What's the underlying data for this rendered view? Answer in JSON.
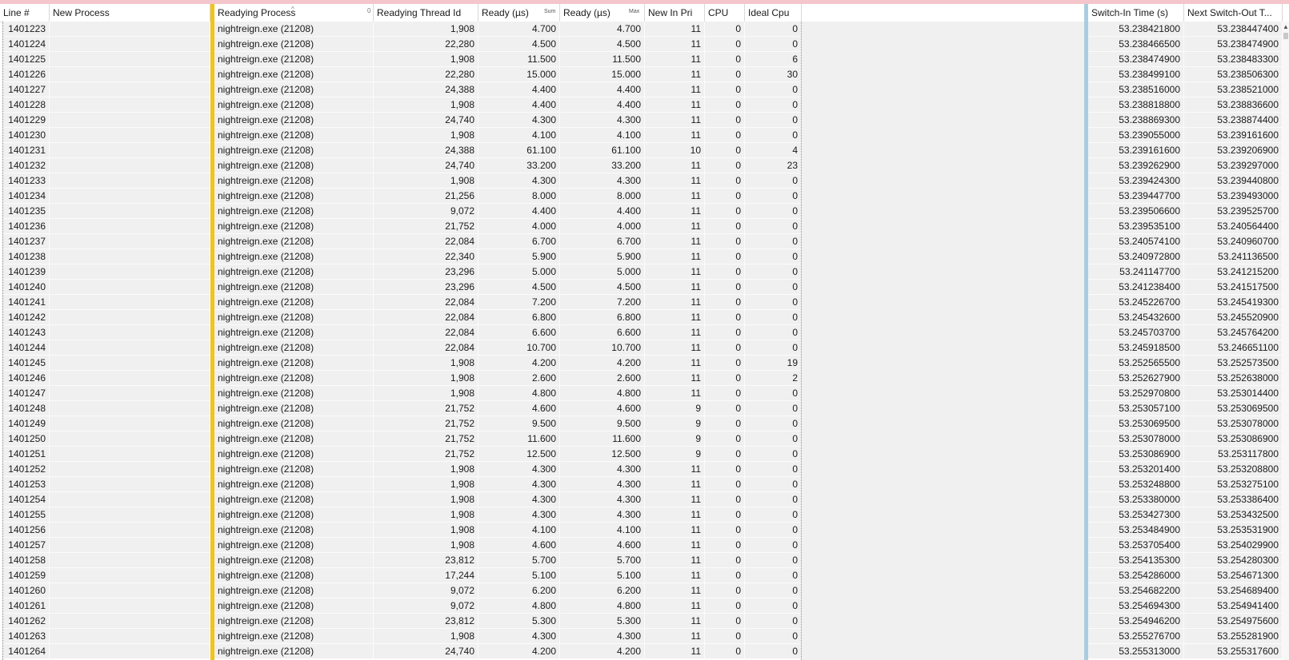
{
  "columns": {
    "line": "Line #",
    "new_process": "New Process",
    "readying_process": "Readying Process",
    "readying_thread_id": "Readying Thread Id",
    "ready_sum": "Ready (µs)",
    "ready_sum_agg": "Sum",
    "ready_max": "Ready (µs)",
    "ready_max_agg": "Max",
    "new_in_pri": "New In Pri",
    "cpu": "CPU",
    "ideal_cpu": "Ideal Cpu",
    "switch_in_time": "Switch-In Time (s)",
    "next_switch_out": "Next Switch-Out T..."
  },
  "header_marks": {
    "sort_arrow": "^",
    "group_mark": "0"
  },
  "rows": [
    {
      "line": "1401223",
      "proc": "nightreign.exe (21208)",
      "tid": "1,908",
      "sum": "4.700",
      "max": "4.700",
      "pri": "11",
      "cpu": "0",
      "ideal": "0",
      "sin": "53.238421800",
      "sout": "53.238447400"
    },
    {
      "line": "1401224",
      "proc": "nightreign.exe (21208)",
      "tid": "22,280",
      "sum": "4.500",
      "max": "4.500",
      "pri": "11",
      "cpu": "0",
      "ideal": "0",
      "sin": "53.238466500",
      "sout": "53.238474900"
    },
    {
      "line": "1401225",
      "proc": "nightreign.exe (21208)",
      "tid": "1,908",
      "sum": "11.500",
      "max": "11.500",
      "pri": "11",
      "cpu": "0",
      "ideal": "6",
      "sin": "53.238474900",
      "sout": "53.238483300"
    },
    {
      "line": "1401226",
      "proc": "nightreign.exe (21208)",
      "tid": "22,280",
      "sum": "15.000",
      "max": "15.000",
      "pri": "11",
      "cpu": "0",
      "ideal": "30",
      "sin": "53.238499100",
      "sout": "53.238506300"
    },
    {
      "line": "1401227",
      "proc": "nightreign.exe (21208)",
      "tid": "24,388",
      "sum": "4.400",
      "max": "4.400",
      "pri": "11",
      "cpu": "0",
      "ideal": "0",
      "sin": "53.238516000",
      "sout": "53.238521000"
    },
    {
      "line": "1401228",
      "proc": "nightreign.exe (21208)",
      "tid": "1,908",
      "sum": "4.400",
      "max": "4.400",
      "pri": "11",
      "cpu": "0",
      "ideal": "0",
      "sin": "53.238818800",
      "sout": "53.238836600"
    },
    {
      "line": "1401229",
      "proc": "nightreign.exe (21208)",
      "tid": "24,740",
      "sum": "4.300",
      "max": "4.300",
      "pri": "11",
      "cpu": "0",
      "ideal": "0",
      "sin": "53.238869300",
      "sout": "53.238874400"
    },
    {
      "line": "1401230",
      "proc": "nightreign.exe (21208)",
      "tid": "1,908",
      "sum": "4.100",
      "max": "4.100",
      "pri": "11",
      "cpu": "0",
      "ideal": "0",
      "sin": "53.239055000",
      "sout": "53.239161600"
    },
    {
      "line": "1401231",
      "proc": "nightreign.exe (21208)",
      "tid": "24,388",
      "sum": "61.100",
      "max": "61.100",
      "pri": "10",
      "cpu": "0",
      "ideal": "4",
      "sin": "53.239161600",
      "sout": "53.239206900"
    },
    {
      "line": "1401232",
      "proc": "nightreign.exe (21208)",
      "tid": "24,740",
      "sum": "33.200",
      "max": "33.200",
      "pri": "11",
      "cpu": "0",
      "ideal": "23",
      "sin": "53.239262900",
      "sout": "53.239297000"
    },
    {
      "line": "1401233",
      "proc": "nightreign.exe (21208)",
      "tid": "1,908",
      "sum": "4.300",
      "max": "4.300",
      "pri": "11",
      "cpu": "0",
      "ideal": "0",
      "sin": "53.239424300",
      "sout": "53.239440800"
    },
    {
      "line": "1401234",
      "proc": "nightreign.exe (21208)",
      "tid": "21,256",
      "sum": "8.000",
      "max": "8.000",
      "pri": "11",
      "cpu": "0",
      "ideal": "0",
      "sin": "53.239447700",
      "sout": "53.239493000"
    },
    {
      "line": "1401235",
      "proc": "nightreign.exe (21208)",
      "tid": "9,072",
      "sum": "4.400",
      "max": "4.400",
      "pri": "11",
      "cpu": "0",
      "ideal": "0",
      "sin": "53.239506600",
      "sout": "53.239525700"
    },
    {
      "line": "1401236",
      "proc": "nightreign.exe (21208)",
      "tid": "21,752",
      "sum": "4.000",
      "max": "4.000",
      "pri": "11",
      "cpu": "0",
      "ideal": "0",
      "sin": "53.239535100",
      "sout": "53.240564400"
    },
    {
      "line": "1401237",
      "proc": "nightreign.exe (21208)",
      "tid": "22,084",
      "sum": "6.700",
      "max": "6.700",
      "pri": "11",
      "cpu": "0",
      "ideal": "0",
      "sin": "53.240574100",
      "sout": "53.240960700"
    },
    {
      "line": "1401238",
      "proc": "nightreign.exe (21208)",
      "tid": "22,340",
      "sum": "5.900",
      "max": "5.900",
      "pri": "11",
      "cpu": "0",
      "ideal": "0",
      "sin": "53.240972800",
      "sout": "53.241136500"
    },
    {
      "line": "1401239",
      "proc": "nightreign.exe (21208)",
      "tid": "23,296",
      "sum": "5.000",
      "max": "5.000",
      "pri": "11",
      "cpu": "0",
      "ideal": "0",
      "sin": "53.241147700",
      "sout": "53.241215200"
    },
    {
      "line": "1401240",
      "proc": "nightreign.exe (21208)",
      "tid": "23,296",
      "sum": "4.500",
      "max": "4.500",
      "pri": "11",
      "cpu": "0",
      "ideal": "0",
      "sin": "53.241238400",
      "sout": "53.241517500"
    },
    {
      "line": "1401241",
      "proc": "nightreign.exe (21208)",
      "tid": "22,084",
      "sum": "7.200",
      "max": "7.200",
      "pri": "11",
      "cpu": "0",
      "ideal": "0",
      "sin": "53.245226700",
      "sout": "53.245419300"
    },
    {
      "line": "1401242",
      "proc": "nightreign.exe (21208)",
      "tid": "22,084",
      "sum": "6.800",
      "max": "6.800",
      "pri": "11",
      "cpu": "0",
      "ideal": "0",
      "sin": "53.245432600",
      "sout": "53.245520900"
    },
    {
      "line": "1401243",
      "proc": "nightreign.exe (21208)",
      "tid": "22,084",
      "sum": "6.600",
      "max": "6.600",
      "pri": "11",
      "cpu": "0",
      "ideal": "0",
      "sin": "53.245703700",
      "sout": "53.245764200"
    },
    {
      "line": "1401244",
      "proc": "nightreign.exe (21208)",
      "tid": "22,084",
      "sum": "10.700",
      "max": "10.700",
      "pri": "11",
      "cpu": "0",
      "ideal": "0",
      "sin": "53.245918500",
      "sout": "53.246651100"
    },
    {
      "line": "1401245",
      "proc": "nightreign.exe (21208)",
      "tid": "1,908",
      "sum": "4.200",
      "max": "4.200",
      "pri": "11",
      "cpu": "0",
      "ideal": "19",
      "sin": "53.252565500",
      "sout": "53.252573500"
    },
    {
      "line": "1401246",
      "proc": "nightreign.exe (21208)",
      "tid": "1,908",
      "sum": "2.600",
      "max": "2.600",
      "pri": "11",
      "cpu": "0",
      "ideal": "2",
      "sin": "53.252627900",
      "sout": "53.252638000"
    },
    {
      "line": "1401247",
      "proc": "nightreign.exe (21208)",
      "tid": "1,908",
      "sum": "4.800",
      "max": "4.800",
      "pri": "11",
      "cpu": "0",
      "ideal": "0",
      "sin": "53.252970800",
      "sout": "53.253014400"
    },
    {
      "line": "1401248",
      "proc": "nightreign.exe (21208)",
      "tid": "21,752",
      "sum": "4.600",
      "max": "4.600",
      "pri": "9",
      "cpu": "0",
      "ideal": "0",
      "sin": "53.253057100",
      "sout": "53.253069500"
    },
    {
      "line": "1401249",
      "proc": "nightreign.exe (21208)",
      "tid": "21,752",
      "sum": "9.500",
      "max": "9.500",
      "pri": "9",
      "cpu": "0",
      "ideal": "0",
      "sin": "53.253069500",
      "sout": "53.253078000"
    },
    {
      "line": "1401250",
      "proc": "nightreign.exe (21208)",
      "tid": "21,752",
      "sum": "11.600",
      "max": "11.600",
      "pri": "9",
      "cpu": "0",
      "ideal": "0",
      "sin": "53.253078000",
      "sout": "53.253086900"
    },
    {
      "line": "1401251",
      "proc": "nightreign.exe (21208)",
      "tid": "21,752",
      "sum": "12.500",
      "max": "12.500",
      "pri": "9",
      "cpu": "0",
      "ideal": "0",
      "sin": "53.253086900",
      "sout": "53.253117800"
    },
    {
      "line": "1401252",
      "proc": "nightreign.exe (21208)",
      "tid": "1,908",
      "sum": "4.300",
      "max": "4.300",
      "pri": "11",
      "cpu": "0",
      "ideal": "0",
      "sin": "53.253201400",
      "sout": "53.253208800"
    },
    {
      "line": "1401253",
      "proc": "nightreign.exe (21208)",
      "tid": "1,908",
      "sum": "4.300",
      "max": "4.300",
      "pri": "11",
      "cpu": "0",
      "ideal": "0",
      "sin": "53.253248800",
      "sout": "53.253275100"
    },
    {
      "line": "1401254",
      "proc": "nightreign.exe (21208)",
      "tid": "1,908",
      "sum": "4.300",
      "max": "4.300",
      "pri": "11",
      "cpu": "0",
      "ideal": "0",
      "sin": "53.253380000",
      "sout": "53.253386400"
    },
    {
      "line": "1401255",
      "proc": "nightreign.exe (21208)",
      "tid": "1,908",
      "sum": "4.300",
      "max": "4.300",
      "pri": "11",
      "cpu": "0",
      "ideal": "0",
      "sin": "53.253427300",
      "sout": "53.253432500"
    },
    {
      "line": "1401256",
      "proc": "nightreign.exe (21208)",
      "tid": "1,908",
      "sum": "4.100",
      "max": "4.100",
      "pri": "11",
      "cpu": "0",
      "ideal": "0",
      "sin": "53.253484900",
      "sout": "53.253531900"
    },
    {
      "line": "1401257",
      "proc": "nightreign.exe (21208)",
      "tid": "1,908",
      "sum": "4.600",
      "max": "4.600",
      "pri": "11",
      "cpu": "0",
      "ideal": "0",
      "sin": "53.253705400",
      "sout": "53.254029900"
    },
    {
      "line": "1401258",
      "proc": "nightreign.exe (21208)",
      "tid": "23,812",
      "sum": "5.700",
      "max": "5.700",
      "pri": "11",
      "cpu": "0",
      "ideal": "0",
      "sin": "53.254135300",
      "sout": "53.254280300"
    },
    {
      "line": "1401259",
      "proc": "nightreign.exe (21208)",
      "tid": "17,244",
      "sum": "5.100",
      "max": "5.100",
      "pri": "11",
      "cpu": "0",
      "ideal": "0",
      "sin": "53.254286000",
      "sout": "53.254671300"
    },
    {
      "line": "1401260",
      "proc": "nightreign.exe (21208)",
      "tid": "9,072",
      "sum": "6.200",
      "max": "6.200",
      "pri": "11",
      "cpu": "0",
      "ideal": "0",
      "sin": "53.254682200",
      "sout": "53.254689400"
    },
    {
      "line": "1401261",
      "proc": "nightreign.exe (21208)",
      "tid": "9,072",
      "sum": "4.800",
      "max": "4.800",
      "pri": "11",
      "cpu": "0",
      "ideal": "0",
      "sin": "53.254694300",
      "sout": "53.254941400"
    },
    {
      "line": "1401262",
      "proc": "nightreign.exe (21208)",
      "tid": "23,812",
      "sum": "5.300",
      "max": "5.300",
      "pri": "11",
      "cpu": "0",
      "ideal": "0",
      "sin": "53.254946200",
      "sout": "53.254975600"
    },
    {
      "line": "1401263",
      "proc": "nightreign.exe (21208)",
      "tid": "1,908",
      "sum": "4.300",
      "max": "4.300",
      "pri": "11",
      "cpu": "0",
      "ideal": "0",
      "sin": "53.255276700",
      "sout": "53.255281900"
    },
    {
      "line": "1401264",
      "proc": "nightreign.exe (21208)",
      "tid": "24,740",
      "sum": "4.200",
      "max": "4.200",
      "pri": "11",
      "cpu": "0",
      "ideal": "0",
      "sin": "53.255313000",
      "sout": "53.255317600"
    }
  ],
  "scrollbar": {
    "up_arrow": "▲"
  },
  "colors": {
    "grouping_bar": "#f2c418",
    "graph_bar": "#a9cde0",
    "top_strip": "#f4c6cb",
    "row_bg": "#f0f0f0"
  }
}
